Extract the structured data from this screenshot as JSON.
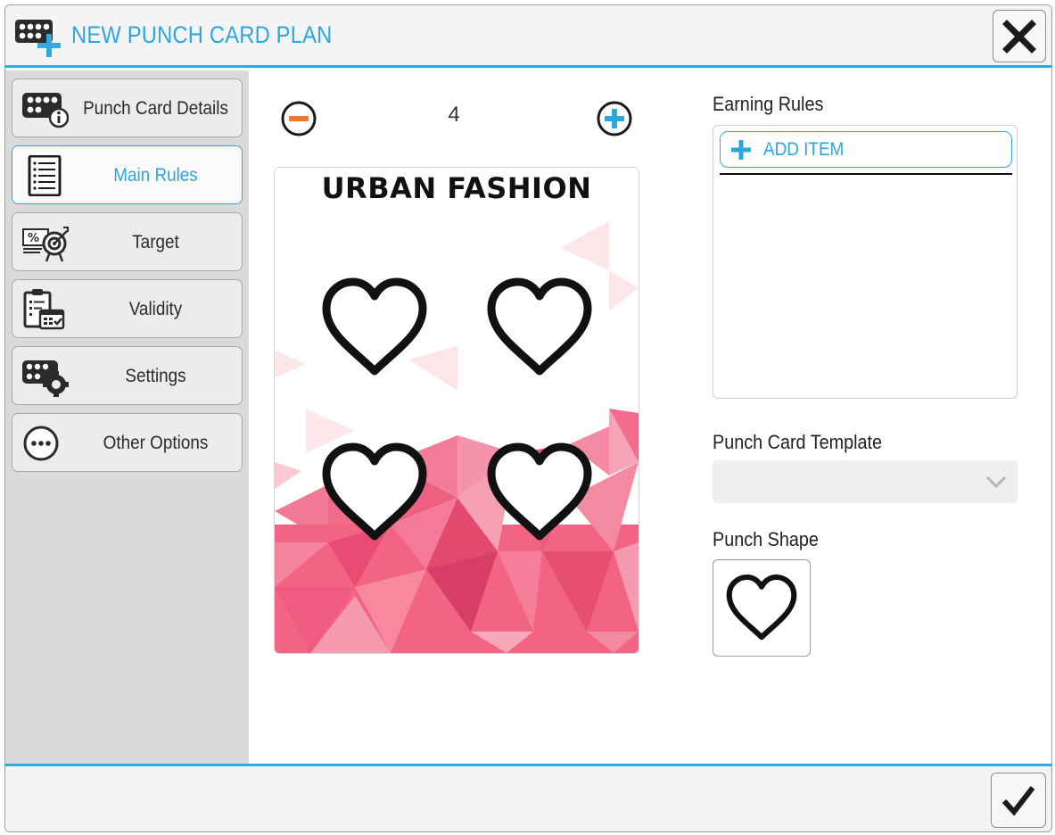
{
  "window": {
    "title": "NEW PUNCH CARD PLAN",
    "title_icon": "punch-card-add-icon",
    "close_icon": "close-icon"
  },
  "sidebar": {
    "items": [
      {
        "label": "Punch Card Details",
        "icon": "punch-card-info-icon",
        "active": false
      },
      {
        "label": "Main Rules",
        "icon": "list-icon",
        "active": true
      },
      {
        "label": "Target",
        "icon": "target-icon",
        "active": false
      },
      {
        "label": "Validity",
        "icon": "clipboard-calendar-icon",
        "active": false
      },
      {
        "label": "Settings",
        "icon": "punch-card-gear-icon",
        "active": false
      },
      {
        "label": "Other Options",
        "icon": "more-options-icon",
        "active": false
      }
    ]
  },
  "stepper": {
    "value": "4",
    "decrement_icon": "minus-circle-icon",
    "increment_icon": "plus-circle-icon"
  },
  "card_preview": {
    "title": "URBAN FASHION",
    "punch_count": 4,
    "punch_icon": "heart-icon"
  },
  "earning_rules": {
    "label": "Earning Rules",
    "add_item_label": "ADD ITEM",
    "add_icon": "plus-icon"
  },
  "template": {
    "label": "Punch Card Template",
    "selected": "",
    "chevron_icon": "chevron-down-icon"
  },
  "punch_shape": {
    "label": "Punch Shape",
    "icon": "heart-icon"
  },
  "footer": {
    "confirm_icon": "checkmark-icon"
  },
  "colors": {
    "accent": "#2ea6dd",
    "minus": "#f07a2a",
    "plus": "#2ea6dd",
    "card_pink": "#f0587a"
  }
}
